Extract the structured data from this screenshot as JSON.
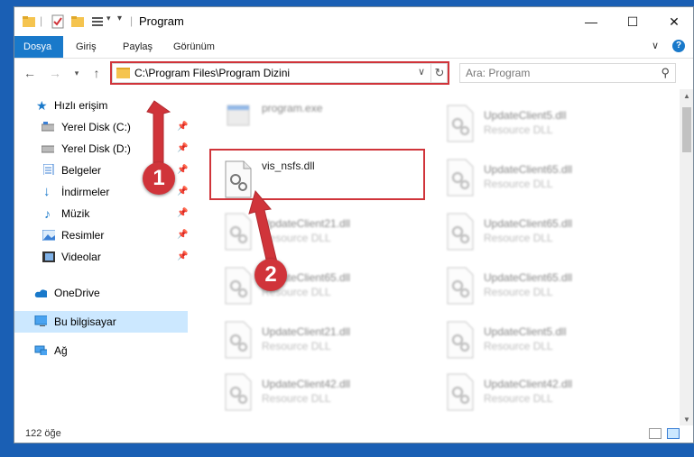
{
  "window": {
    "title": "Program",
    "controls": {
      "minimize": "—",
      "maximize": "☐",
      "close": "✕"
    }
  },
  "ribbon": {
    "tabs": [
      "Dosya",
      "Giriş",
      "Paylaş",
      "Görünüm"
    ],
    "active_tab": "Dosya"
  },
  "address": {
    "path": "C:\\Program Files\\Program Dizini"
  },
  "search": {
    "placeholder": "Ara: Program"
  },
  "navpane": {
    "quick_access": "Hızlı erişim",
    "items": [
      {
        "label": "Yerel Disk (C:)",
        "icon": "drive-icon"
      },
      {
        "label": "Yerel Disk (D:)",
        "icon": "drive-icon"
      },
      {
        "label": "Belgeler",
        "icon": "documents-icon"
      },
      {
        "label": "İndirmeler",
        "icon": "downloads-icon"
      },
      {
        "label": "Müzik",
        "icon": "music-icon"
      },
      {
        "label": "Resimler",
        "icon": "pictures-icon"
      },
      {
        "label": "Videolar",
        "icon": "videos-icon"
      }
    ],
    "onedrive": "OneDrive",
    "this_pc": "Bu bilgisayar",
    "network": "Ağ"
  },
  "files": {
    "left": [
      {
        "name": "program.exe",
        "desc": ""
      },
      {
        "name": "vis_nsfs.dll",
        "desc": ""
      },
      {
        "name": "UpdateClient21.dll",
        "desc": "Resource DLL"
      },
      {
        "name": "UpdateClient65.dll",
        "desc": "Resource DLL"
      },
      {
        "name": "UpdateClient21.dll",
        "desc": "Resource DLL"
      },
      {
        "name": "UpdateClient42.dll",
        "desc": "Resource DLL"
      }
    ],
    "right": [
      {
        "name": "UpdateClient5.dll",
        "desc": "Resource DLL"
      },
      {
        "name": "UpdateClient65.dll",
        "desc": "Resource DLL"
      },
      {
        "name": "UpdateClient65.dll",
        "desc": "Resource DLL"
      },
      {
        "name": "UpdateClient65.dll",
        "desc": "Resource DLL"
      },
      {
        "name": "UpdateClient5.dll",
        "desc": "Resource DLL"
      },
      {
        "name": "UpdateClient42.dll",
        "desc": "Resource DLL"
      }
    ]
  },
  "status": {
    "count": "122 öğe"
  },
  "annotations": {
    "step1": "1",
    "step2": "2",
    "color": "#d0343a"
  }
}
